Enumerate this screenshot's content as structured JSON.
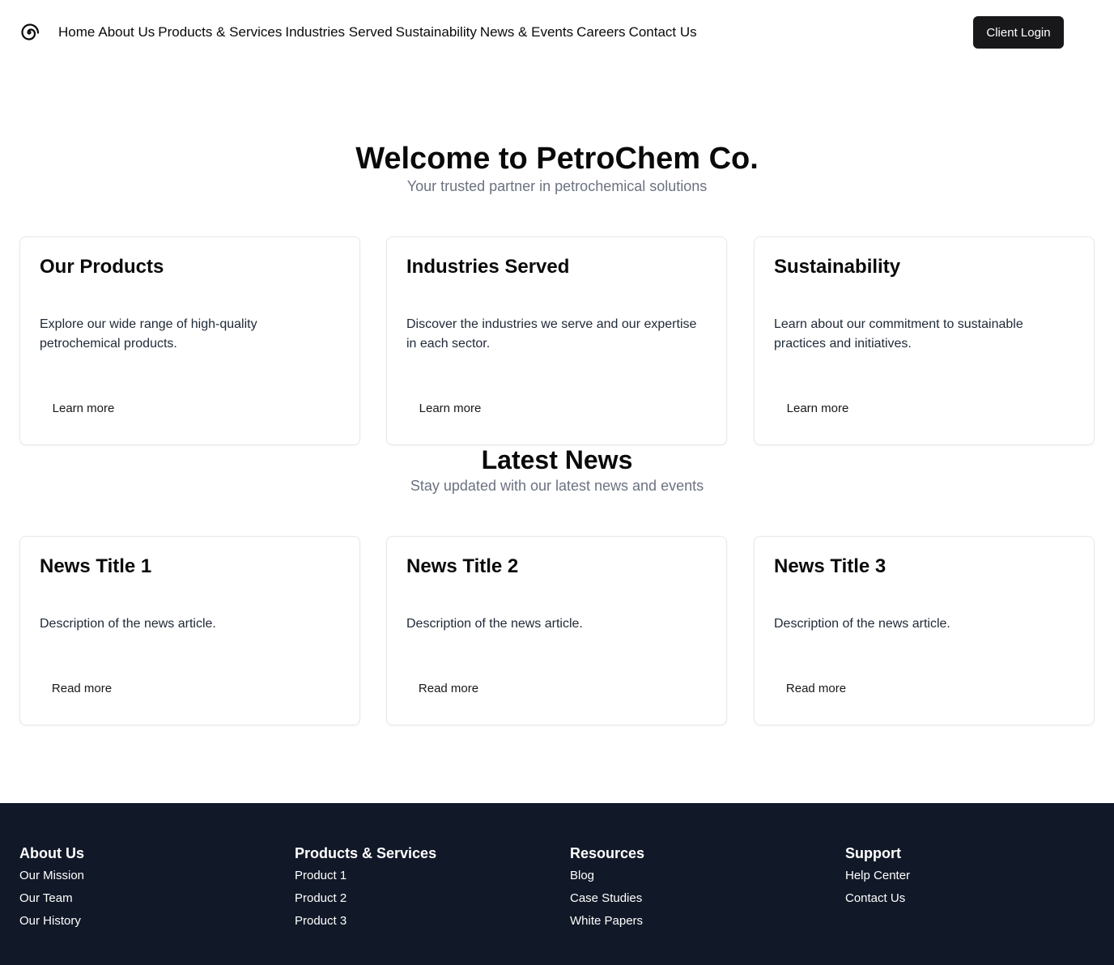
{
  "header": {
    "nav": [
      "Home",
      "About Us",
      "Products & Services",
      "Industries Served",
      "Sustainability",
      "News & Events",
      "Careers",
      "Contact Us"
    ],
    "login_label": "Client Login"
  },
  "hero": {
    "title": "Welcome to PetroChem Co.",
    "subtitle": "Your trusted partner in petrochemical solutions"
  },
  "features": [
    {
      "title": "Our Products",
      "text": "Explore our wide range of high-quality petrochemical products.",
      "link": "Learn more"
    },
    {
      "title": "Industries Served",
      "text": "Discover the industries we serve and our expertise in each sector.",
      "link": "Learn more"
    },
    {
      "title": "Sustainability",
      "text": "Learn about our commitment to sustainable practices and initiatives.",
      "link": "Learn more"
    }
  ],
  "news": {
    "title": "Latest News",
    "subtitle": "Stay updated with our latest news and events",
    "items": [
      {
        "title": "News Title 1",
        "text": "Description of the news article.",
        "link": "Read more"
      },
      {
        "title": "News Title 2",
        "text": "Description of the news article.",
        "link": "Read more"
      },
      {
        "title": "News Title 3",
        "text": "Description of the news article.",
        "link": "Read more"
      }
    ]
  },
  "footer": {
    "columns": [
      {
        "title": "About Us",
        "links": [
          "Our Mission",
          "Our Team",
          "Our History"
        ]
      },
      {
        "title": "Products & Services",
        "links": [
          "Product 1",
          "Product 2",
          "Product 3"
        ]
      },
      {
        "title": "Resources",
        "links": [
          "Blog",
          "Case Studies",
          "White Papers"
        ]
      },
      {
        "title": "Support",
        "links": [
          "Help Center",
          "Contact Us"
        ]
      }
    ]
  },
  "colors": {
    "footer_bg": "#111827",
    "button_bg": "#18181b",
    "muted_text": "#6b7280"
  }
}
